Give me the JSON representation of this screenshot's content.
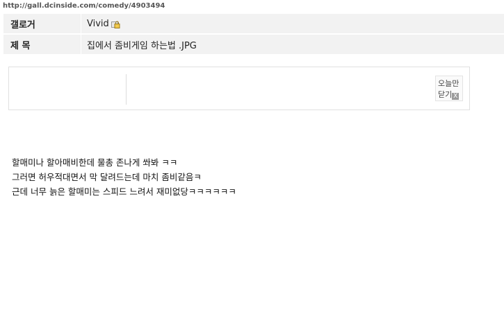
{
  "url": "http://gall.dcinside.com/comedy/4903494",
  "post_info": {
    "author_label": "갤로거",
    "author_value": "Vivid",
    "title_label": "제 목",
    "title_value": "집에서 좀비게임 하는법 .JPG"
  },
  "notice": {
    "close_line1": "오늘만",
    "close_line2": "닫기",
    "close_x": "X"
  },
  "body_lines": [
    "할매미나 할아매비한데 물총 존나게 쏴봐 ㅋㅋ",
    "그러면 허우적대면서 막 달려드는데 마치 좀비같음ㅋ",
    "근데 너무 늙은 할매미는 스피드 느려서 재미없당ㅋㅋㅋㅋㅋㅋ"
  ]
}
